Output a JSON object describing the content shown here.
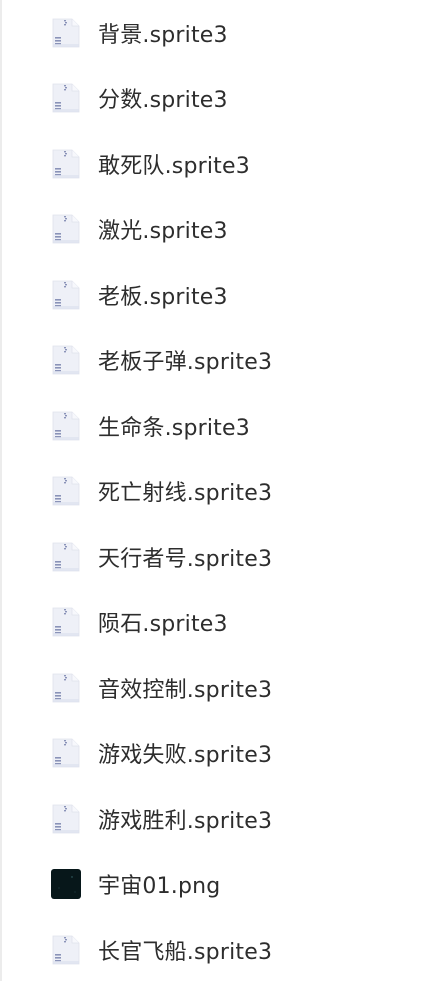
{
  "files": [
    {
      "name": "背景.sprite3",
      "icon": "sprite-file-icon",
      "type": "sprite"
    },
    {
      "name": "分数.sprite3",
      "icon": "sprite-file-icon",
      "type": "sprite"
    },
    {
      "name": "敢死队.sprite3",
      "icon": "sprite-file-icon",
      "type": "sprite"
    },
    {
      "name": "激光.sprite3",
      "icon": "sprite-file-icon",
      "type": "sprite"
    },
    {
      "name": "老板.sprite3",
      "icon": "sprite-file-icon",
      "type": "sprite"
    },
    {
      "name": "老板子弹.sprite3",
      "icon": "sprite-file-icon",
      "type": "sprite"
    },
    {
      "name": "生命条.sprite3",
      "icon": "sprite-file-icon",
      "type": "sprite"
    },
    {
      "name": "死亡射线.sprite3",
      "icon": "sprite-file-icon",
      "type": "sprite"
    },
    {
      "name": "天行者号.sprite3",
      "icon": "sprite-file-icon",
      "type": "sprite"
    },
    {
      "name": "陨石.sprite3",
      "icon": "sprite-file-icon",
      "type": "sprite"
    },
    {
      "name": "音效控制.sprite3",
      "icon": "sprite-file-icon",
      "type": "sprite"
    },
    {
      "name": "游戏失败.sprite3",
      "icon": "sprite-file-icon",
      "type": "sprite"
    },
    {
      "name": "游戏胜利.sprite3",
      "icon": "sprite-file-icon",
      "type": "sprite"
    },
    {
      "name": "宇宙01.png",
      "icon": "image-thumbnail-icon",
      "type": "image"
    },
    {
      "name": "长官飞船.sprite3",
      "icon": "sprite-file-icon",
      "type": "sprite"
    }
  ],
  "colors": {
    "file_icon_body": "#eef0f7",
    "file_icon_lines": "#8a93b8",
    "image_thumb": "#07171a"
  }
}
